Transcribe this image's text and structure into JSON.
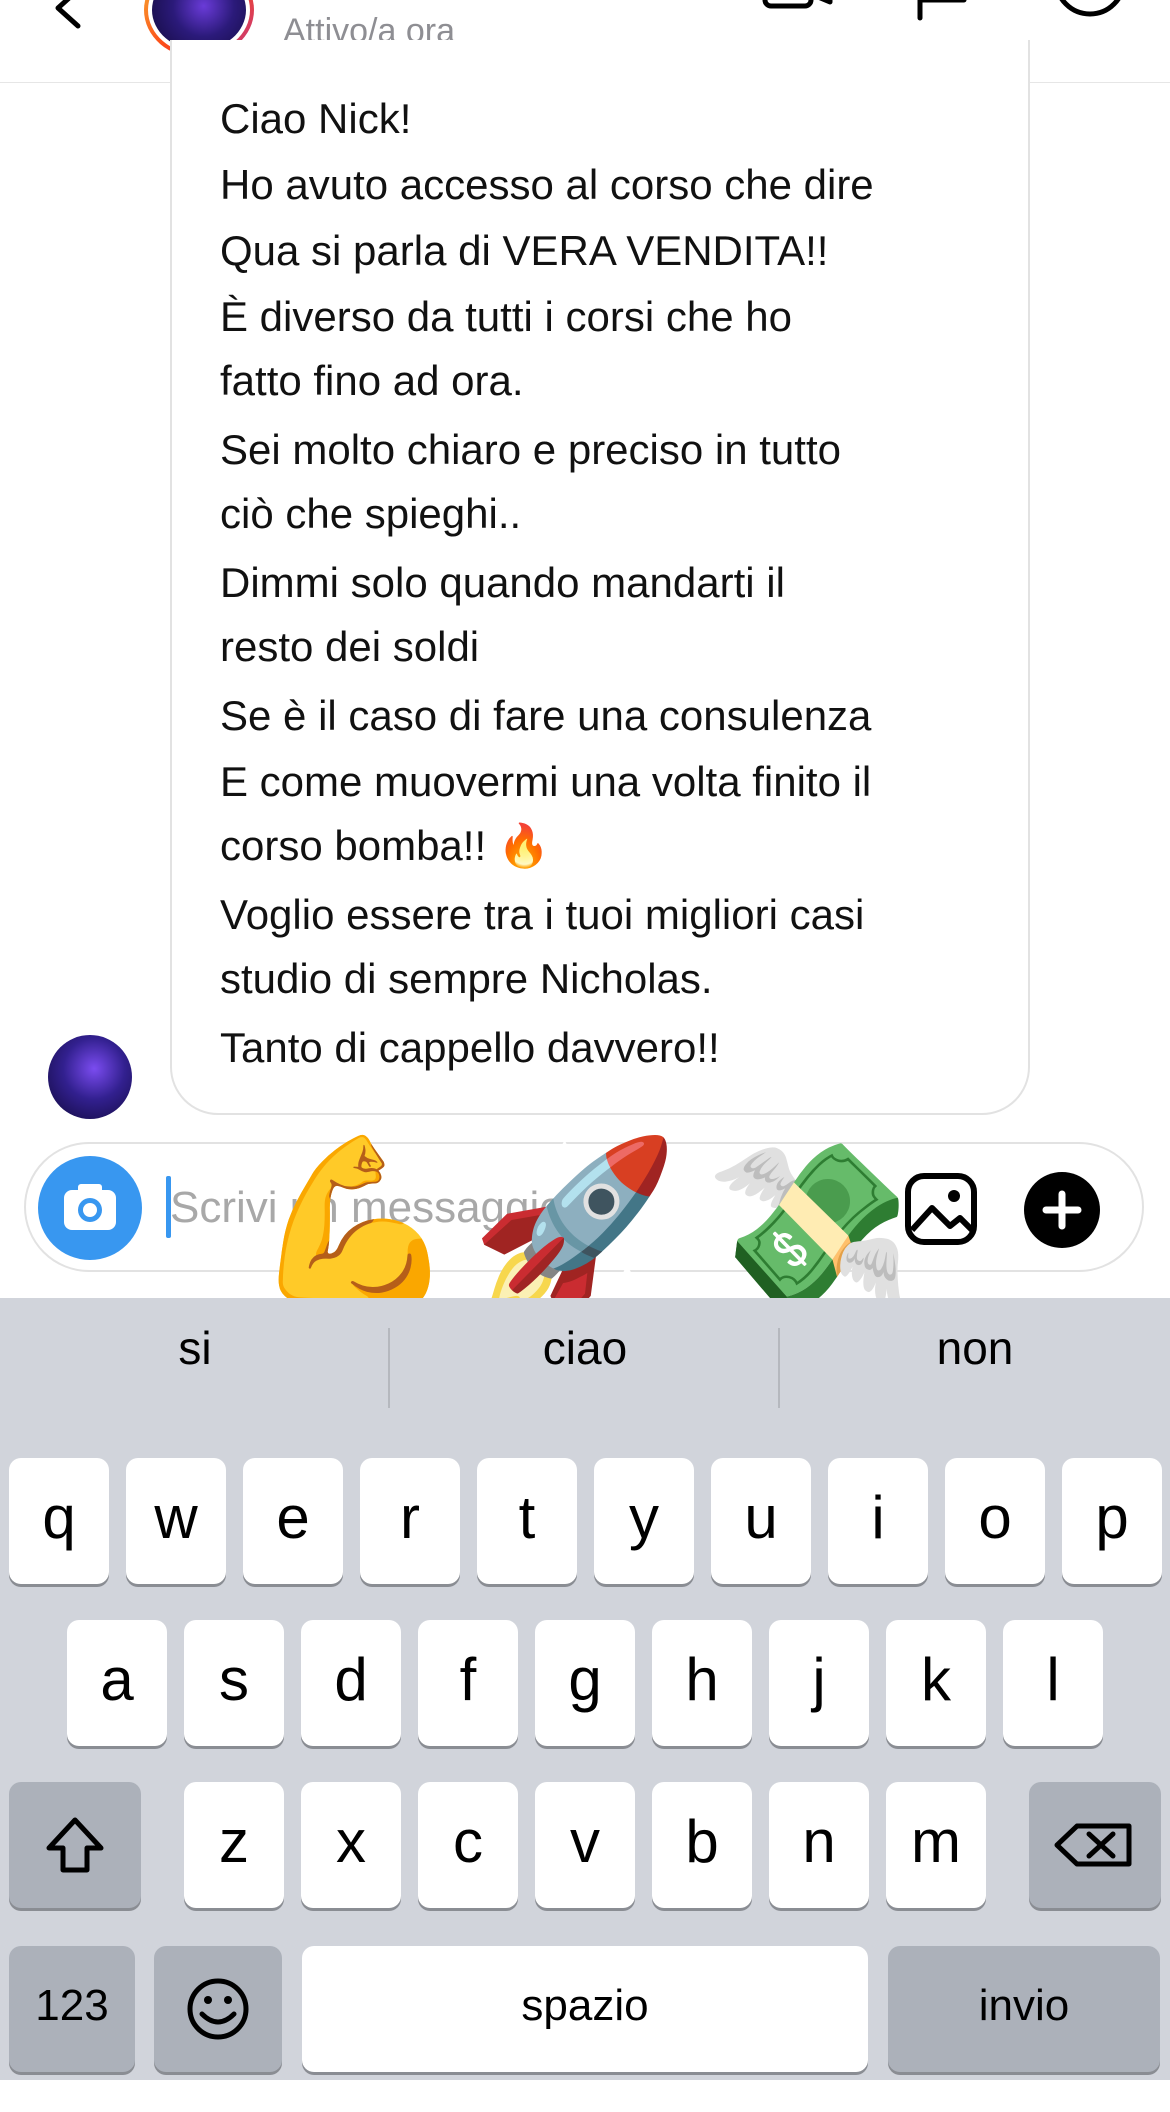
{
  "header": {
    "status": "Attivo/a ora",
    "icons": [
      "back-icon",
      "video-call-icon",
      "flag-icon",
      "info-icon"
    ]
  },
  "message": {
    "lines": [
      "Ciao Nick!",
      "Ho avuto accesso al corso che dire",
      "Qua si parla di  VERA VENDITA!!",
      "È diverso da tutti i corsi che ho",
      "fatto fino ad ora.",
      "Sei molto chiaro e preciso in tutto",
      "ciò che spieghi..",
      "Dimmi solo quando mandarti il",
      "resto dei soldi",
      "Se è il caso di fare una consulenza",
      "E come muovermi una volta finito il",
      "corso bomba!! 🔥",
      "Voglio essere tra i tuoi migliori casi",
      "studio di sempre Nicholas.",
      "Tanto di cappello davvero!!"
    ]
  },
  "composer": {
    "placeholder": "Scrivi un messaggio...",
    "value": "",
    "stickers": [
      "💪",
      "🚀",
      "💸"
    ]
  },
  "keyboard": {
    "suggestions": [
      "si",
      "ciao",
      "non"
    ],
    "row1": [
      "q",
      "w",
      "e",
      "r",
      "t",
      "y",
      "u",
      "i",
      "o",
      "p"
    ],
    "row2": [
      "a",
      "s",
      "d",
      "f",
      "g",
      "h",
      "j",
      "k",
      "l"
    ],
    "row3": [
      "z",
      "x",
      "c",
      "v",
      "b",
      "n",
      "m"
    ],
    "numbers_key": "123",
    "space_key": "spazio",
    "return_key": "invio"
  },
  "colors": {
    "accent": "#3897f0",
    "keyboard_bg": "#d1d4db",
    "status_gray": "#8e8e93"
  }
}
